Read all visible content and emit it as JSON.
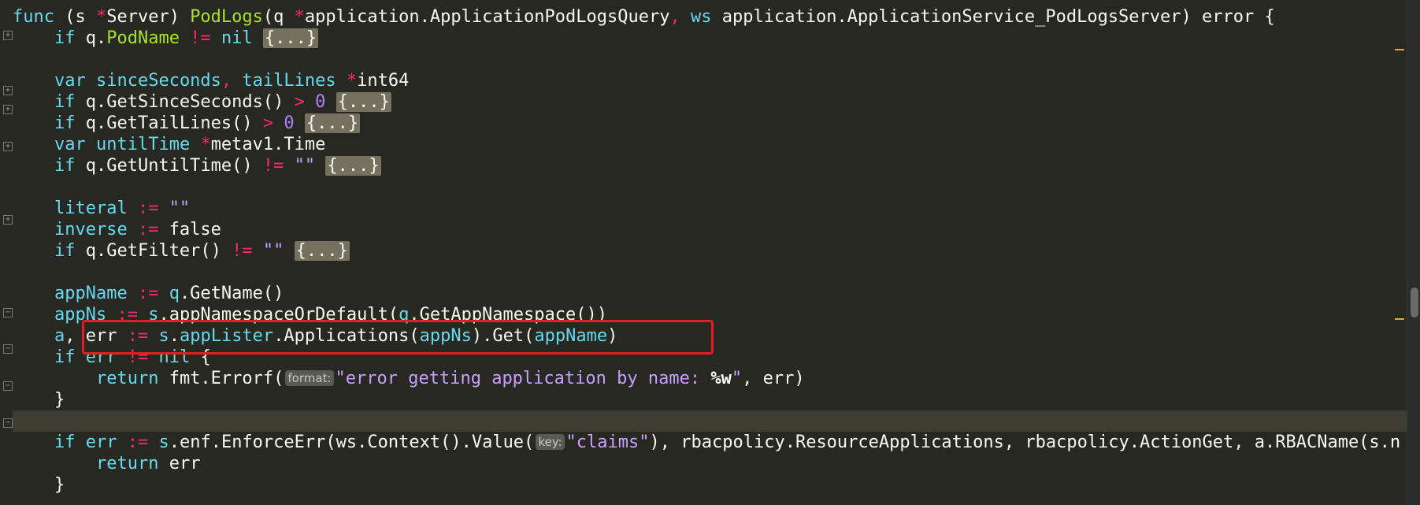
{
  "editor": {
    "lines": [
      [
        "func (s *Server) PodLogs(q *application.ApplicationPodLogsQuery, ws application.ApplicationService_PodLogsServer) error {"
      ],
      [
        "    if q.PodName != nil ",
        "{...}"
      ],
      [
        ""
      ],
      [
        "    var sinceSeconds, tailLines *int64"
      ],
      [
        "    if q.GetSinceSeconds() > 0 ",
        "{...}"
      ],
      [
        "    if q.GetTailLines() > 0 ",
        "{...}"
      ],
      [
        "    var untilTime *metav1.Time"
      ],
      [
        "    if q.GetUntilTime() != \"\" ",
        "{...}"
      ],
      [
        ""
      ],
      [
        "    literal := \"\""
      ],
      [
        "    inverse := false"
      ],
      [
        "    if q.GetFilter() != \"\" ",
        "{...}"
      ],
      [
        ""
      ],
      [
        "    appName := q.GetName()"
      ],
      [
        "    appNs := s.appNamespaceOrDefault(q.GetAppNamespace())"
      ],
      [
        "    a, err := s.appLister.Applications(appNs).Get(appName)"
      ],
      [
        "    if err != nil {"
      ],
      [
        "        return fmt.Errorf(",
        "format:",
        "\"error getting application by name: %w\", err)"
      ],
      [
        "    }"
      ],
      [
        ""
      ],
      [
        "    if err := s.enf.EnforceErr(ws.Context().Value(",
        "key:",
        "\"claims\"), rbacpolicy.ResourceApplications, rbacpolicy.ActionGet, a.RBACName(s.n"
      ],
      [
        "        return err"
      ],
      [
        "    }"
      ]
    ]
  },
  "tokens": {
    "l0": "func",
    "l0b": " (s ",
    "l0c": "*",
    "l0d": "Server) ",
    "l0e": "PodLogs",
    "l0f": "(q ",
    "l0g": "*",
    "l0h": "application.ApplicationPodLogsQuery",
    "l0i": ", ",
    "l0j": "ws",
    "l0k": " application.ApplicationService_PodLogsServer) error {",
    "l1a": "if",
    "l1b": " q.",
    "l1c": "PodName",
    "l1d": " != ",
    "l1e": "nil",
    "l1f": "{...}",
    "l3a": "var",
    "l3b": " sinceSeconds",
    "l3c": ", ",
    "l3d": "tailLines ",
    "l3e": "*",
    "l3f": "int64",
    "l4a": "if",
    "l4b": " q.GetSinceSeconds() ",
    "l4c": "> ",
    "l4d": "0",
    "l4e": "{...}",
    "l5a": "if",
    "l5b": " q.GetTailLines() ",
    "l5c": "> ",
    "l5d": "0",
    "l5e": "{...}",
    "l6a": "var",
    "l6b": " untilTime ",
    "l6c": "*",
    "l6d": "metav1.Time",
    "l7a": "if",
    "l7b": " q.GetUntilTime() ",
    "l7c": "!= ",
    "l7d": "\"\"",
    "l7e": "{...}",
    "l9a": "literal",
    "l9b": " := ",
    "l9c": "\"\"",
    "l10a": "inverse",
    "l10b": " := ",
    "l10c": "false",
    "l11a": "if",
    "l11b": " q.GetFilter() ",
    "l11c": "!= ",
    "l11d": "\"\"",
    "l11e": "{...}",
    "l13a": "appName",
    "l13b": " := ",
    "l13c": "q",
    "l13d": ".GetName()",
    "l14a": "appNs",
    "l14b": " := ",
    "l14c": "s",
    "l14d": ".appNamespaceOrDefault(",
    "l14e": "q",
    "l14f": ".GetAppNamespace())",
    "l15a": "a",
    "l15b": ", err ",
    "l15c": ":= ",
    "l15d": "s",
    "l15e": ".",
    "l15f": "appLister",
    "l15g": ".Applications(",
    "l15h": "appNs",
    "l15i": ").Get(",
    "l15j": "appName",
    "l15k": ")",
    "l16a": "if",
    "l16b": " err ",
    "l16c": "!= ",
    "l16d": "nil",
    "l16e": " {",
    "l17a": "return",
    "l17b": " fmt.Errorf(",
    "l17c": "format:",
    "l17d": "\"error getting application by name: ",
    "l17e": "%w",
    "l17f": "\"",
    "l17g": ", err)",
    "l18a": "}",
    "l20a": "if",
    "l20b": " err ",
    "l20c": ":= ",
    "l20d": "s",
    "l20e": ".enf.EnforceErr(ws.Context().Value(",
    "l20f": "key:",
    "l20g": "\"claims\"",
    "l20h": "), rbacpolicy.ResourceApplications, rbacpolicy.ActionGet, a.RBACName(s.n",
    "l21a": "return",
    "l21b": " err",
    "l22a": "}"
  },
  "colors": {
    "background": "#272822",
    "keyword": "#66d9ef",
    "operator": "#f92672",
    "string": "#c8a0ff",
    "highlight_box": "#e21d24",
    "current_line": "#3e3d32"
  },
  "icons": {
    "fold": "fold-toggle-icon",
    "scroll": "scrollbar-thumb"
  }
}
